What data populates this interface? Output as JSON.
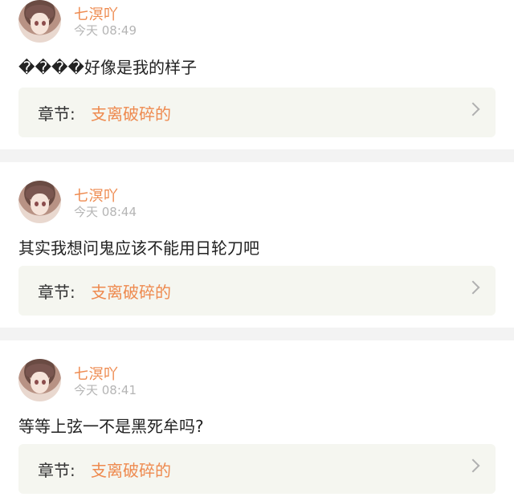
{
  "comments": [
    {
      "username": "七溟吖",
      "time": "今天 08:49",
      "text": "����好像是我的样子",
      "chapter_label": "章节:",
      "chapter_title": "支离破碎的"
    },
    {
      "username": "七溟吖",
      "time": "今天 08:44",
      "text": "其实我想问鬼应该不能用日轮刀吧",
      "chapter_label": "章节:",
      "chapter_title": "支离破碎的"
    },
    {
      "username": "七溟吖",
      "time": "今天 08:41",
      "text": "等等上弦一不是黑死牟吗?",
      "chapter_label": "章节:",
      "chapter_title": "支离破碎的"
    }
  ],
  "icons": {
    "avatar": "user-avatar",
    "chevron": "chevron-right-icon"
  },
  "colors": {
    "accent": "#ee8a4f",
    "muted": "#b5b5b5",
    "card": "#f5f6f0",
    "divider": "#f3f3f3"
  }
}
